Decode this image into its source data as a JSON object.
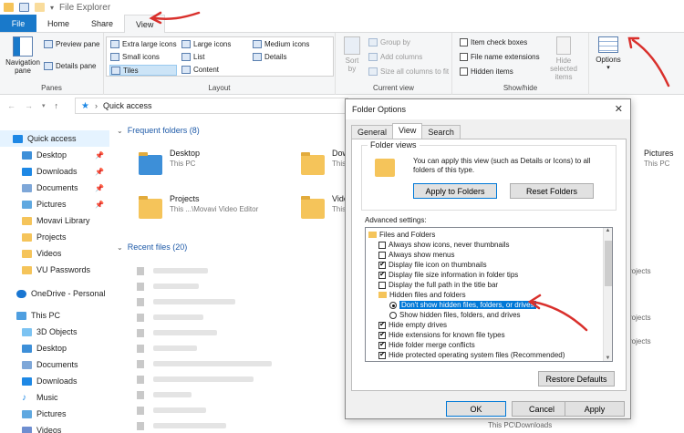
{
  "window": {
    "title": "File Explorer"
  },
  "tabs": [
    "File",
    "Home",
    "Share",
    "View"
  ],
  "ribbon": {
    "panes": {
      "label": "Panes",
      "navigation_pane": "Navigation pane",
      "preview_pane": "Preview pane",
      "details_pane": "Details pane"
    },
    "layout": {
      "label": "Layout",
      "items": [
        "Extra large icons",
        "Large icons",
        "Medium icons",
        "Small icons",
        "List",
        "Details",
        "Tiles",
        "Content"
      ],
      "selected": "Tiles"
    },
    "current_view": {
      "label": "Current view",
      "sort_by": "Sort by",
      "group_by": "Group by",
      "add_columns": "Add columns",
      "size_all": "Size all columns to fit"
    },
    "show_hide": {
      "label": "Show/hide",
      "item_check_boxes": "Item check boxes",
      "file_name_extensions": "File name extensions",
      "hidden_items": "Hidden items",
      "hide_selected_items": "Hide selected items"
    },
    "options": "Options"
  },
  "address": {
    "location": "Quick access"
  },
  "nav": {
    "items": [
      "Quick access",
      "Desktop",
      "Downloads",
      "Documents",
      "Pictures",
      "Movavi Library",
      "Projects",
      "Videos",
      "VU Passwords",
      "OneDrive - Personal",
      "This PC",
      "3D Objects",
      "Desktop",
      "Documents",
      "Downloads",
      "Music",
      "Pictures",
      "Videos"
    ]
  },
  "content": {
    "frequent_header": "Frequent folders (8)",
    "recent_header": "Recent files (20)",
    "tiles": [
      {
        "name": "Desktop",
        "sub": "This PC"
      },
      {
        "name": "Projects",
        "sub": "This ...\\Movavi Video Editor"
      },
      {
        "name": "Dow",
        "sub": "This"
      },
      {
        "name": "Vide",
        "sub": "This"
      },
      {
        "name": "Pictures",
        "sub": "This PC"
      }
    ],
    "right_labels": [
      "rojects",
      "rojects",
      "rojects"
    ],
    "last_path": "This PC\\Downloads"
  },
  "dialog": {
    "title": "Folder Options",
    "tabs": [
      "General",
      "View",
      "Search"
    ],
    "active_tab": "View",
    "folder_views_legend": "Folder views",
    "folder_views_text": "You can apply this view (such as Details or Icons) to all folders of this type.",
    "apply_to_folders": "Apply to Folders",
    "reset_folders": "Reset Folders",
    "advanced_label": "Advanced settings:",
    "advanced_items": [
      {
        "kind": "folder",
        "text": "Files and Folders"
      },
      {
        "kind": "check",
        "checked": false,
        "text": "Always show icons, never thumbnails"
      },
      {
        "kind": "check",
        "checked": false,
        "text": "Always show menus"
      },
      {
        "kind": "check",
        "checked": true,
        "text": "Display file icon on thumbnails"
      },
      {
        "kind": "check",
        "checked": true,
        "text": "Display file size information in folder tips"
      },
      {
        "kind": "check",
        "checked": false,
        "text": "Display the full path in the title bar"
      },
      {
        "kind": "folder",
        "text": "Hidden files and folders"
      },
      {
        "kind": "radio",
        "checked": true,
        "text": "Don't show hidden files, folders, or drives",
        "highlight": true
      },
      {
        "kind": "radio",
        "checked": false,
        "text": "Show hidden files, folders, and drives"
      },
      {
        "kind": "check",
        "checked": true,
        "text": "Hide empty drives"
      },
      {
        "kind": "check",
        "checked": true,
        "text": "Hide extensions for known file types"
      },
      {
        "kind": "check",
        "checked": true,
        "text": "Hide folder merge conflicts"
      },
      {
        "kind": "check",
        "checked": true,
        "text": "Hide protected operating system files (Recommended)"
      }
    ],
    "restore_defaults": "Restore Defaults",
    "ok": "OK",
    "cancel": "Cancel",
    "apply": "Apply"
  },
  "colors": {
    "accent": "#0078d7",
    "file_tab": "#1979ca",
    "annotation": "#d9302c",
    "folder": "#f5c45a"
  }
}
